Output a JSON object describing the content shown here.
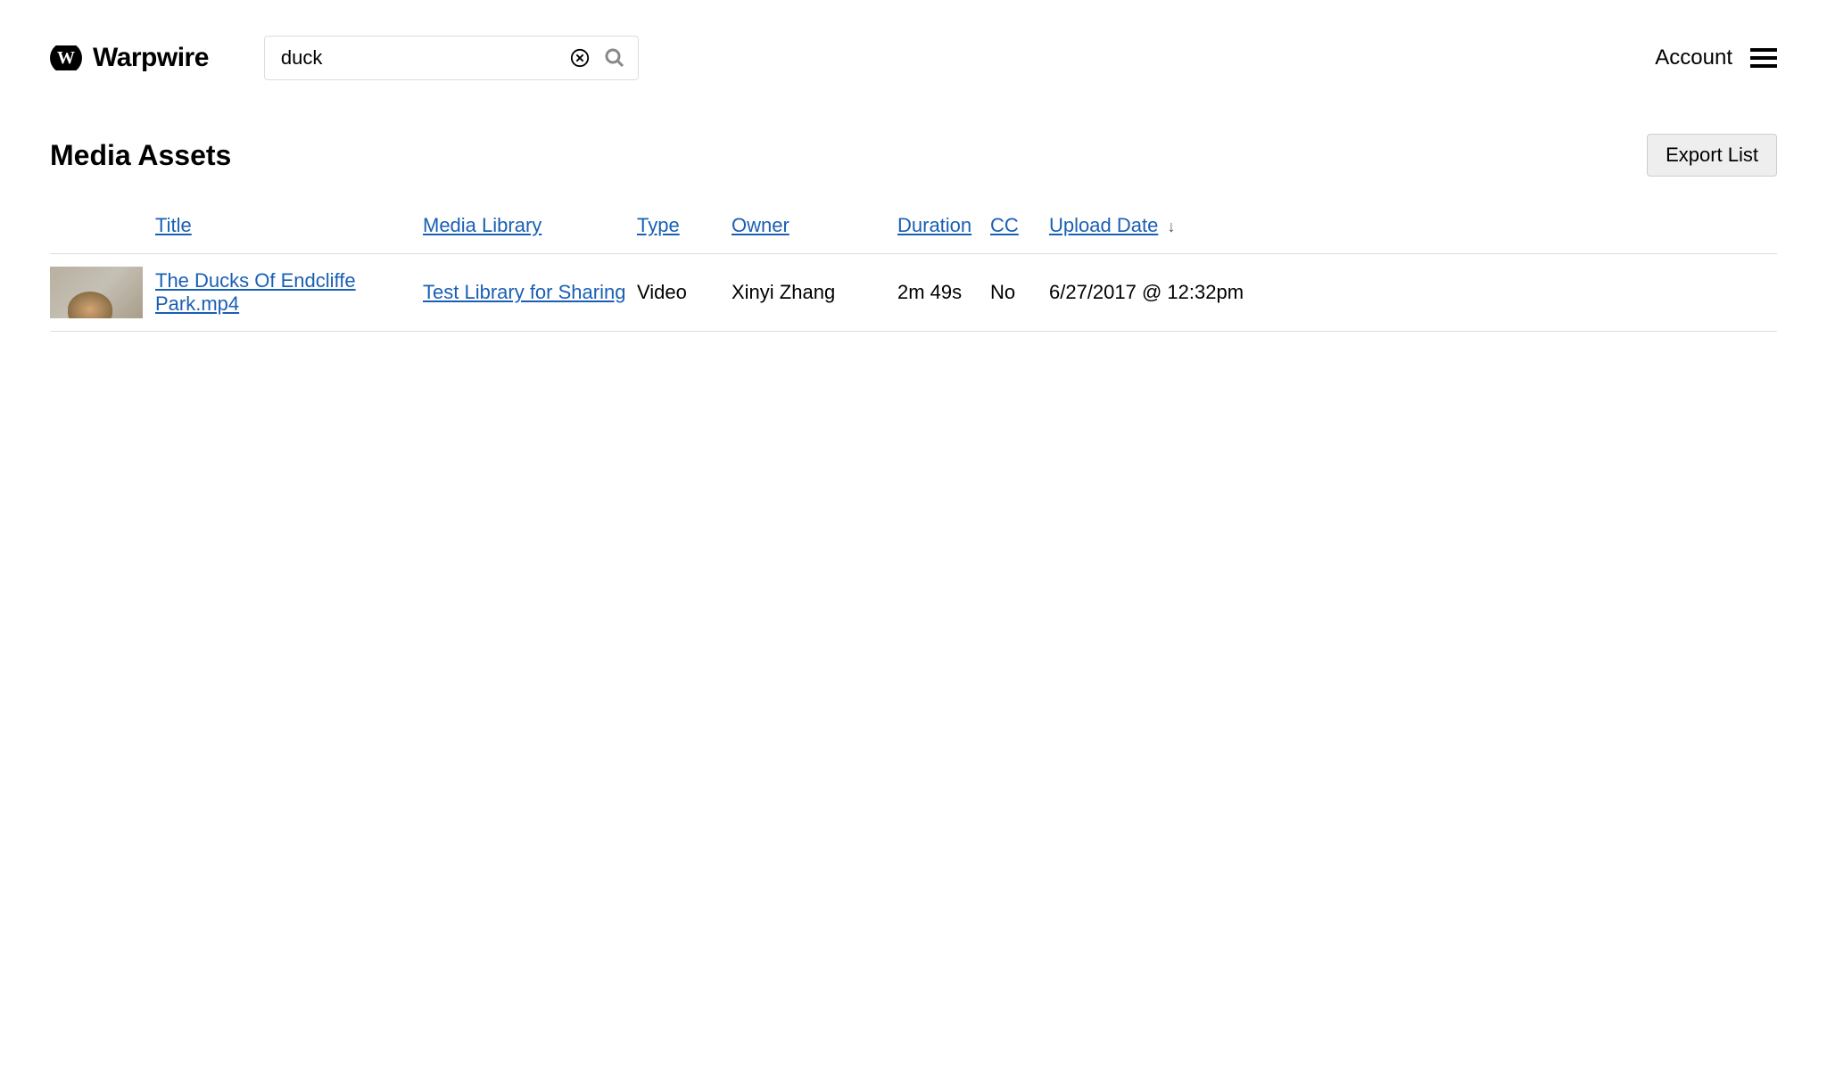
{
  "brand": "Warpwire",
  "search": {
    "value": "duck"
  },
  "header": {
    "account_label": "Account"
  },
  "page": {
    "title": "Media Assets",
    "export_label": "Export List"
  },
  "columns": {
    "title": "Title",
    "library": "Media Library",
    "type": "Type",
    "owner": "Owner",
    "duration": "Duration",
    "cc": "CC",
    "upload": "Upload Date",
    "sort_indicator": "↓"
  },
  "rows": [
    {
      "title": "The Ducks Of Endcliffe Park.mp4",
      "library": "Test Library for Sharing",
      "type": "Video",
      "owner": "Xinyi Zhang",
      "duration": "2m 49s",
      "cc": "No",
      "upload": "6/27/2017 @ 12:32pm"
    }
  ]
}
